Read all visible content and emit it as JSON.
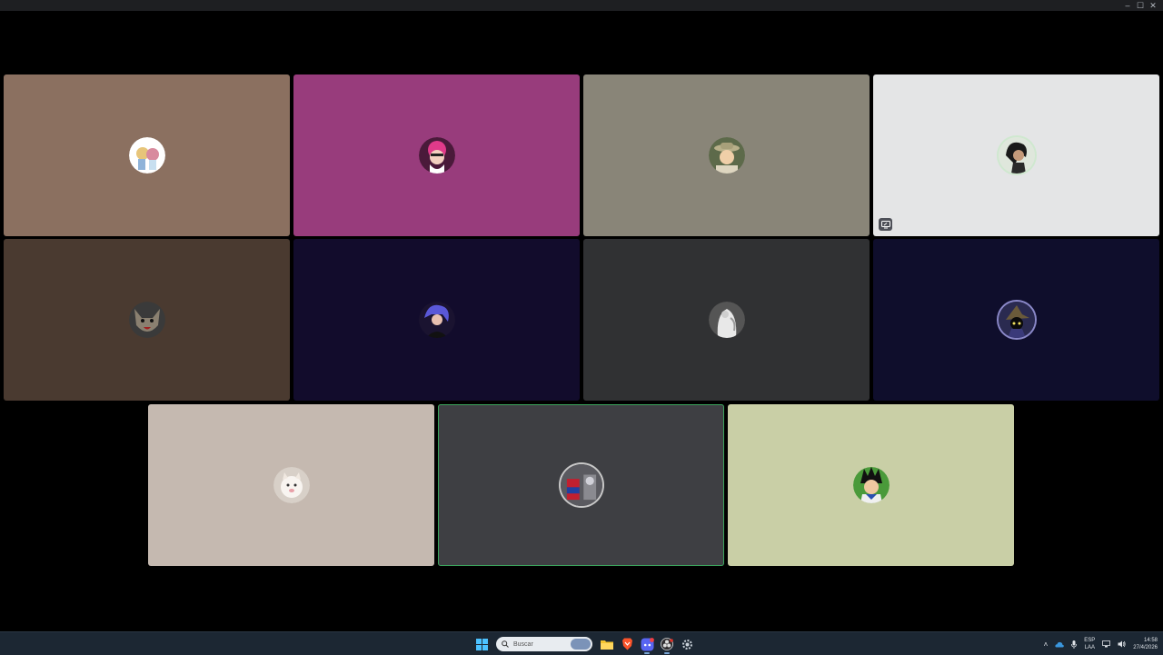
{
  "window": {
    "controls": {
      "minimize": "–",
      "maximize": "☐",
      "close": "✕"
    }
  },
  "participants": [
    {
      "id": "p1",
      "bg": "#8b7060",
      "avatar": "anime-blonde-avatar",
      "speaking": false
    },
    {
      "id": "p2",
      "bg": "#983c7c",
      "avatar": "pink-haired-glasses-avatar",
      "speaking": false
    },
    {
      "id": "p3",
      "bg": "#898578",
      "avatar": "man-in-hat-avatar",
      "speaking": false
    },
    {
      "id": "p4",
      "bg": "#e4e5e6",
      "avatar": "dark-haired-avatar",
      "speaking": false,
      "badge": "screen-share-icon"
    },
    {
      "id": "p5",
      "bg": "#4a3a30",
      "avatar": "wolf-avatar",
      "speaking": false
    },
    {
      "id": "p6",
      "bg": "#120c2c",
      "avatar": "purple-haired-avatar",
      "speaking": false
    },
    {
      "id": "p7",
      "bg": "#303133",
      "avatar": "white-statue-avatar",
      "speaking": false
    },
    {
      "id": "p8",
      "bg": "#0f0e2c",
      "avatar": "black-mage-avatar",
      "speaking": false
    },
    {
      "id": "p9",
      "bg": "#c5b9b0",
      "avatar": "white-cat-avatar",
      "speaking": false
    },
    {
      "id": "p10",
      "bg": "#3e3f43",
      "avatar": "superhero-avatar",
      "speaking": true
    },
    {
      "id": "p11",
      "bg": "#c9cfa6",
      "avatar": "vegeta-avatar",
      "speaking": false
    }
  ],
  "taskbar": {
    "search_placeholder": "Buscar",
    "pinned": [
      "windows-start-icon",
      "file-explorer-icon",
      "brave-browser-icon",
      "discord-icon",
      "obs-icon",
      "settings-icon"
    ],
    "tray": {
      "language_line1": "ESP",
      "language_line2": "LAA",
      "time": "14:58",
      "date": "27/4/2026"
    }
  }
}
